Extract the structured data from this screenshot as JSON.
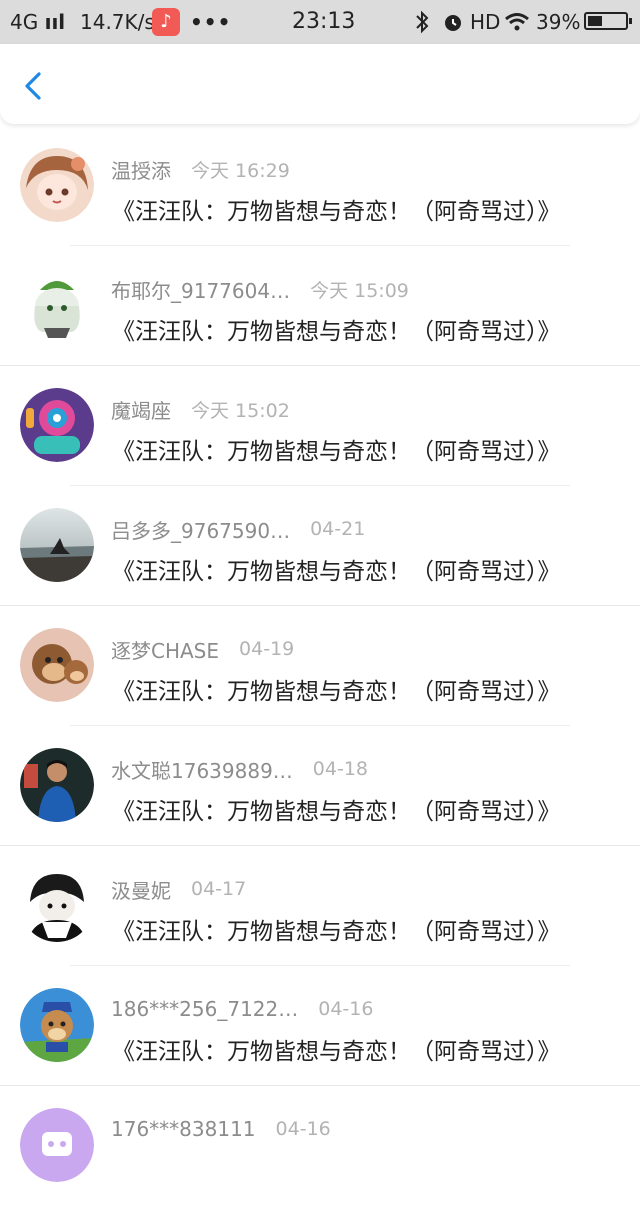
{
  "status_bar": {
    "network": "4G",
    "signal_bars": "ııl",
    "speed": "14.7K/s",
    "dots": "•••",
    "time": "23:13",
    "hd": "HD",
    "battery_text": "39%",
    "battery_level": 0.39
  },
  "header": {
    "back_icon": "chevron-left-icon",
    "accent_color": "#1e88e5"
  },
  "list": {
    "items": [
      {
        "name": "温授添",
        "time": "今天 16:29",
        "title": "《汪汪队：万物皆想与奇恋！（阿奇骂过）》",
        "avatar": "anime-girl-avatar"
      },
      {
        "name": "布耶尔_9177604…",
        "time": "今天 15:09",
        "title": "《汪汪队：万物皆想与奇恋！（阿奇骂过）》",
        "avatar": "chibi-character-avatar"
      },
      {
        "name": "魔竭座",
        "time": "今天 15:02",
        "title": "《汪汪队：万物皆想与奇恋！（阿奇骂过）》",
        "avatar": "robot-character-avatar"
      },
      {
        "name": "吕多多_9767590…",
        "time": "04-21",
        "title": "《汪汪队：万物皆想与奇恋！（阿奇骂过）》",
        "avatar": "seaside-photo-avatar"
      },
      {
        "name": "逐梦CHASE",
        "time": "04-19",
        "title": "《汪汪队：万物皆想与奇恋！（阿奇骂过）》",
        "avatar": "monkey-cartoon-avatar"
      },
      {
        "name": "水文聪17639889…",
        "time": "04-18",
        "title": "《汪汪队：万物皆想与奇恋！（阿奇骂过）》",
        "avatar": "person-photo-avatar"
      },
      {
        "name": "汲曼妮",
        "time": "04-17",
        "title": "《汪汪队：万物皆想与奇恋！（阿奇骂过）》",
        "avatar": "anime-boy-avatar"
      },
      {
        "name": "186***256_7122…",
        "time": "04-16",
        "title": "《汪汪队：万物皆想与奇恋！（阿奇骂过）》",
        "avatar": "cartoon-dog-avatar"
      },
      {
        "name": "176***838111",
        "time": "04-16",
        "title": "",
        "avatar": "default-purple-avatar"
      }
    ]
  }
}
